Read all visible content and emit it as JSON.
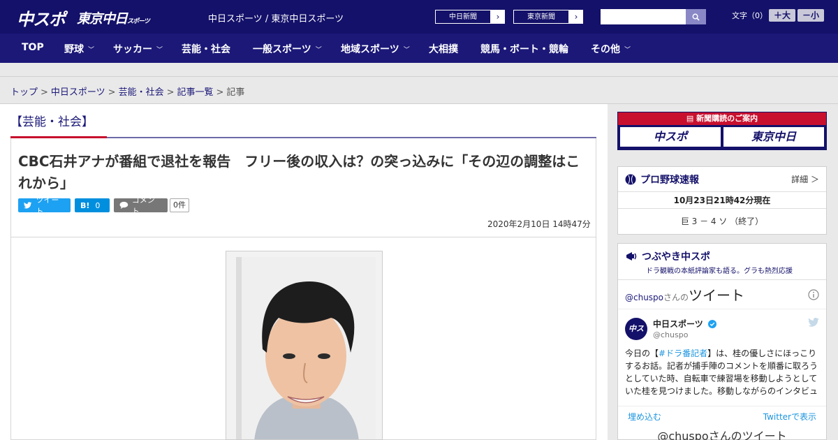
{
  "header": {
    "logo_main": "中スポ",
    "logo_tokyo": "東京中日",
    "logo_tokyo_small": "スポーツ",
    "site_title": "中日スポーツ / 東京中日スポーツ",
    "ext_links": [
      {
        "label": "中日新聞",
        "arrow": "›"
      },
      {
        "label": "東京新聞",
        "arrow": "›"
      }
    ],
    "search_placeholder": "",
    "font_label": "文字（0）",
    "font_up": "＋大",
    "font_down": "－小"
  },
  "nav": {
    "items": [
      {
        "label": "TOP",
        "has_menu": false
      },
      {
        "label": "野球",
        "has_menu": true
      },
      {
        "label": "サッカー",
        "has_menu": true
      },
      {
        "label": "芸能・社会",
        "has_menu": false
      },
      {
        "label": "一般スポーツ",
        "has_menu": true
      },
      {
        "label": "地域スポーツ",
        "has_menu": true
      },
      {
        "label": "大相撲",
        "has_menu": false
      },
      {
        "label": "競馬・ボート・競輪",
        "has_menu": false
      },
      {
        "label": "その他",
        "has_menu": true
      }
    ]
  },
  "breadcrumb": {
    "items": [
      "トップ",
      "中日スポーツ",
      "芸能・社会",
      "記事一覧"
    ],
    "current": "記事",
    "separator": ">"
  },
  "article": {
    "category": "【芸能・社会】",
    "title": "CBC石井アナが番組で退社を報告　フリー後の収入は？の突っ込みに「その辺の調整はこれから」",
    "tweet_label": "ツイート",
    "hatena_label": "B!",
    "hatena_count": "0",
    "comment_label": "コメント",
    "comment_count": "0件",
    "date": "2020年2月10日 14時47分"
  },
  "sidebar": {
    "ad": {
      "head": "新聞購読のご案内",
      "logo1": "中スポ",
      "logo2": "東京中日"
    },
    "baseball": {
      "title": "プロ野球速報",
      "more": "詳細 ＞",
      "date": "10月23日21時42分現在",
      "score": "巨 3 － 4 ソ （終了）"
    },
    "tweets": {
      "title": "つぶやき中スポ",
      "subtitle": "ドラ観戦の本紙評論家も語る。グラも熱烈応援",
      "handle_prefix": "@chuspo",
      "handle_suffix": "さんの",
      "handle_big": "ツイート",
      "avatar_text": "中スポ",
      "name": "中日スポーツ",
      "user": "@chuspo",
      "text_before": "今日の【",
      "hashtag": "#ドラ番記者",
      "text_after": "】は、桂の優しさにほっこりするお話。記者が捕手陣のコメントを順番に取ろうとしていた時、自転車で練習場を移動しようとしていた桂を見つけました。移動しながらのインタビュ",
      "embed": "埋め込む",
      "view_on": "Twitterで表示",
      "footer": "@chuspoさんのツイート"
    }
  }
}
